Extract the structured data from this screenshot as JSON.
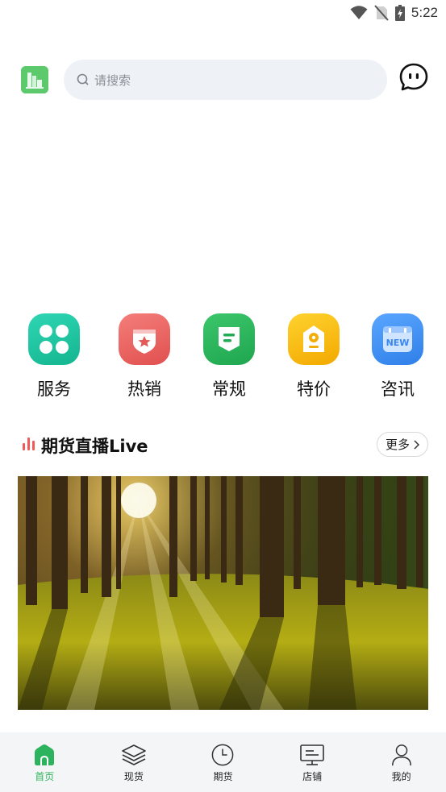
{
  "status_bar": {
    "time": "5:22"
  },
  "header": {
    "search_placeholder": "请搜索"
  },
  "categories": [
    {
      "label": "服务",
      "icon": "clover-icon",
      "color": "#1dbd9a"
    },
    {
      "label": "热销",
      "icon": "star-badge-icon",
      "color": "#ec6664"
    },
    {
      "label": "常规",
      "icon": "bookmark-list-icon",
      "color": "#27b35a"
    },
    {
      "label": "特价",
      "icon": "price-tag-icon",
      "color": "#f7b705"
    },
    {
      "label": "咨讯",
      "icon": "new-calendar-icon",
      "color": "#3f8cf2",
      "badge": "NEW"
    }
  ],
  "live_section": {
    "title": "期货直播Live",
    "more_label": "更多"
  },
  "tabbar": {
    "items": [
      {
        "label": "首页",
        "icon": "home-icon",
        "active": true
      },
      {
        "label": "现货",
        "icon": "layers-icon",
        "active": false
      },
      {
        "label": "期货",
        "icon": "clock-icon",
        "active": false
      },
      {
        "label": "店铺",
        "icon": "store-board-icon",
        "active": false
      },
      {
        "label": "我的",
        "icon": "user-icon",
        "active": false
      }
    ]
  },
  "colors": {
    "accent": "#2db35d",
    "search_bg": "#eef2f6",
    "tabbar_bg": "#f3f5f7"
  }
}
